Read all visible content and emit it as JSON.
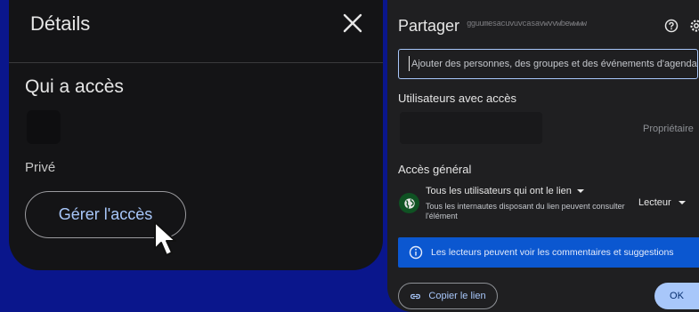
{
  "details": {
    "title": "Détails",
    "who_has_access": "Qui a accès",
    "visibility": "Privé",
    "manage_access_label": "Gérer l'accès"
  },
  "share": {
    "title": "Partager",
    "filename": "gguumesacuvuvcasavwvvwbewwww",
    "add_placeholder": "Ajouter des personnes, des groupes et des événements d'agenda",
    "users_heading": "Utilisateurs avec accès",
    "owner_role": "Propriétaire",
    "general_heading": "Accès général",
    "link_scope": "Tous les utilisateurs qui ont le lien",
    "link_scope_desc": "Tous les internautes disposant du lien peuvent consulter l'élément",
    "role": "Lecteur",
    "info_text": "Les lecteurs peuvent voir les commentaires et suggestions",
    "copy_link_label": "Copier le lien",
    "ok_label": "OK"
  },
  "icons": {
    "close": "close-icon",
    "help": "help-icon",
    "settings": "gear-icon",
    "globe": "globe-icon",
    "info": "info-icon",
    "link": "link-icon",
    "cursor": "mouse-pointer-icon"
  },
  "colors": {
    "background": "#0a168c",
    "panel": "#141416",
    "dialog": "#1f1f21",
    "accent": "#a8c7fa",
    "banner": "#0b57d0",
    "globe_bg": "#0f5223"
  }
}
